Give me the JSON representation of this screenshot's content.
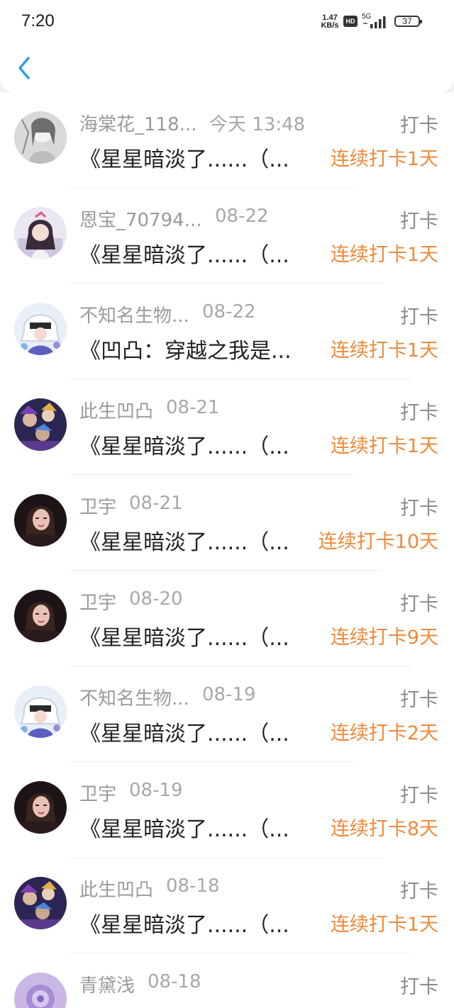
{
  "status_bar": {
    "time": "7:20",
    "speed_value": "1.47",
    "speed_unit": "KB/s",
    "hd": "HD",
    "network": "5G",
    "battery": "37"
  },
  "list": [
    {
      "name": "海棠花_118...",
      "date": "今天 13:48",
      "type": "打卡",
      "title": "《星星暗淡了......（...",
      "streak": "连续打卡1天",
      "avatar": "sketch-girl"
    },
    {
      "name": "恩宝_70794...",
      "date": "08-22",
      "type": "打卡",
      "title": "《星星暗淡了......（...",
      "streak": "连续打卡1天",
      "avatar": "anime-girl"
    },
    {
      "name": "不知名生物...",
      "date": "08-22",
      "type": "打卡",
      "title": "《凹凸：穿越之我是...",
      "streak": "连续打卡1天",
      "avatar": "anime-white-hair"
    },
    {
      "name": "此生凹凸",
      "date": "08-21",
      "type": "打卡",
      "title": "《星星暗淡了......（...",
      "streak": "连续打卡1天",
      "avatar": "anime-group"
    },
    {
      "name": "卫宇",
      "date": "08-21",
      "type": "打卡",
      "title": "《星星暗淡了......（...",
      "streak": "连续打卡10天",
      "avatar": "portrait-woman"
    },
    {
      "name": "卫宇",
      "date": "08-20",
      "type": "打卡",
      "title": "《星星暗淡了......（...",
      "streak": "连续打卡9天",
      "avatar": "portrait-woman"
    },
    {
      "name": "不知名生物...",
      "date": "08-19",
      "type": "打卡",
      "title": "《星星暗淡了......（...",
      "streak": "连续打卡2天",
      "avatar": "anime-white-hair"
    },
    {
      "name": "卫宇",
      "date": "08-19",
      "type": "打卡",
      "title": "《星星暗淡了......（...",
      "streak": "连续打卡8天",
      "avatar": "portrait-woman"
    },
    {
      "name": "此生凹凸",
      "date": "08-18",
      "type": "打卡",
      "title": "《星星暗淡了......（...",
      "streak": "连续打卡1天",
      "avatar": "anime-group"
    },
    {
      "name": "青黛浅",
      "date": "08-18",
      "type": "打卡",
      "title": "",
      "streak": "",
      "avatar": "purple-flower"
    }
  ],
  "colors": {
    "accent_back": "#2f9df2",
    "streak": "#ef8a3a",
    "muted_text": "#9a9a9a"
  }
}
